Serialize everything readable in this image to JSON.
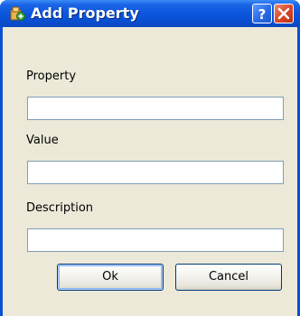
{
  "window": {
    "title": "Add Property",
    "title_icon": "add-property-icon",
    "help_icon": "help-icon",
    "close_icon": "close-icon"
  },
  "form": {
    "property_label": "Property",
    "property_value": "",
    "value_label": "Value",
    "value_value": "",
    "description_label": "Description",
    "description_value": ""
  },
  "buttons": {
    "ok_label": "Ok",
    "cancel_label": "Cancel"
  },
  "colors": {
    "titlebar": "#0b56dd",
    "client_bg": "#ece9d8",
    "close_button": "#d9482a",
    "input_border": "#7f9db9"
  }
}
